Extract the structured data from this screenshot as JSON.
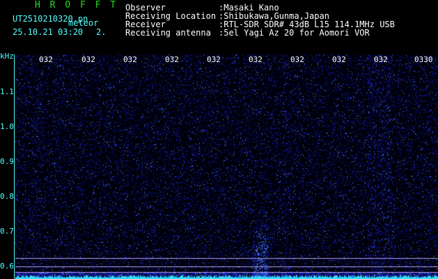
{
  "header": {
    "title": "H R O F F T",
    "filename": "UT2510210320.pn",
    "mode": "meteor",
    "datetime": "25.10.21 03:20",
    "count": "2.",
    "info": [
      {
        "label": "Observer",
        "value": ":Masaki Kano"
      },
      {
        "label": "Receiving Location",
        "value": ":Shibukawa,Gunma,Japan"
      },
      {
        "label": "Receiver",
        "value": ":RTL-SDR SDR# 43dB L15 114.1MHz USB"
      },
      {
        "label": "Receiving antenna",
        "value": ":5el Yagi Az 20 for Aomori VOR"
      }
    ]
  },
  "axis": {
    "unit": "kHz",
    "y_ticks": [
      "1.1",
      "1.0",
      "0.9",
      "0.8",
      "0.7",
      "0.6"
    ],
    "x_ticks": [
      "032",
      "032",
      "032",
      "032",
      "032",
      "032",
      "032",
      "032",
      "032",
      "0330"
    ]
  },
  "colors": {
    "background": "#000000",
    "noise": "#1a2aa8",
    "signal": "#4fa0ff",
    "axis": "#55ffff",
    "title": "#22dd22"
  }
}
